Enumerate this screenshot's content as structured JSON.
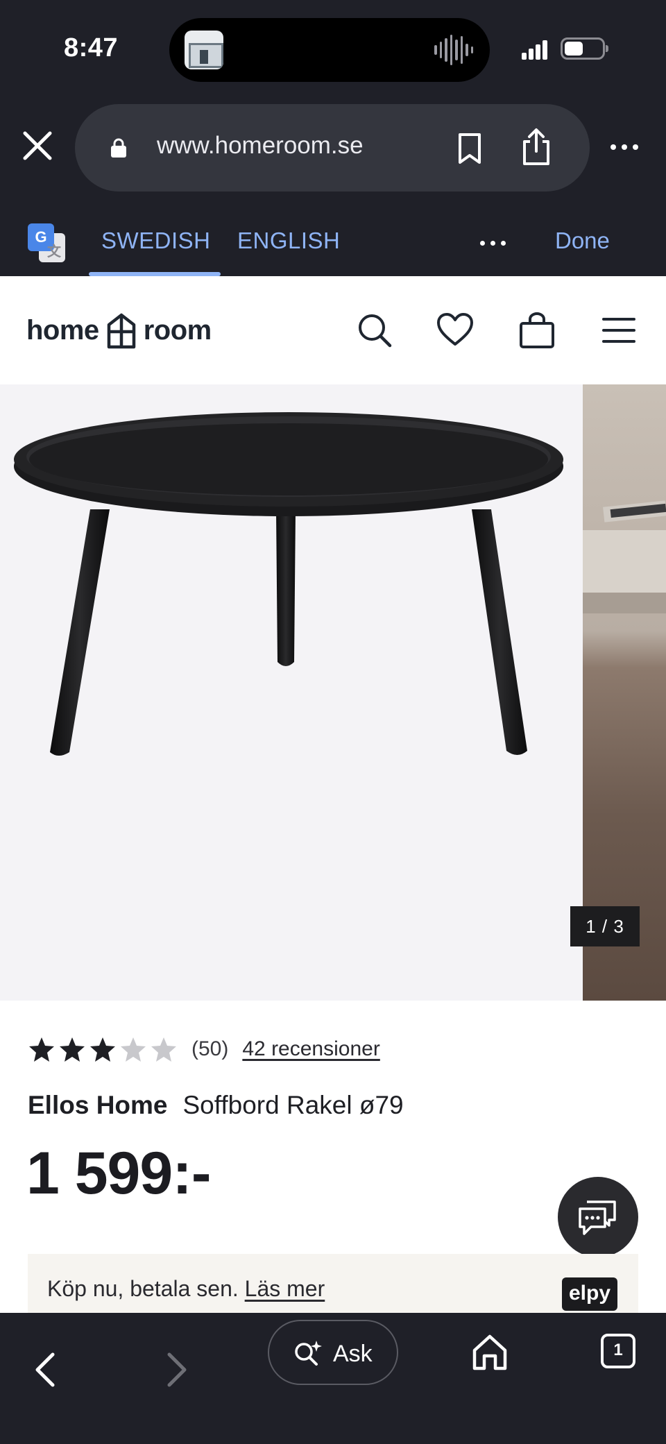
{
  "status_bar": {
    "time": "8:47"
  },
  "browser": {
    "url": "www.homeroom.se",
    "icons": {
      "close": "close-icon",
      "lock": "lock-icon",
      "bookmark": "bookmark-icon",
      "share": "share-icon",
      "more": "more-icon"
    }
  },
  "translate_bar": {
    "languages": [
      "SWEDISH",
      "ENGLISH"
    ],
    "active_language": "SWEDISH",
    "done_label": "Done"
  },
  "site_header": {
    "logo_left": "home",
    "logo_right": "room",
    "icons": [
      "search-icon",
      "heart-icon",
      "bag-icon",
      "menu-icon"
    ]
  },
  "gallery": {
    "counter": "1 / 3",
    "current_index": 1,
    "total": 3
  },
  "product": {
    "rating": 3,
    "rating_max": 5,
    "rating_count": "(50)",
    "reviews_link": "42 recensioner",
    "brand": "Ellos Home",
    "name": "Soffbord Rakel ø79",
    "price": "1 599:-"
  },
  "payment_banner": {
    "text": "Köp nu, betala sen.",
    "link": "Läs mer",
    "badge": "elpy"
  },
  "bottom_bar": {
    "ask_label": "Ask",
    "tab_count": "1"
  },
  "colors": {
    "chrome_bg": "#1f2028",
    "urlbar_bg": "#34363e",
    "accent_blue": "#8fb4f5",
    "page_bg": "#ffffff",
    "gallery_bg": "#f4f3f6",
    "text_dark": "#1e1f24"
  }
}
